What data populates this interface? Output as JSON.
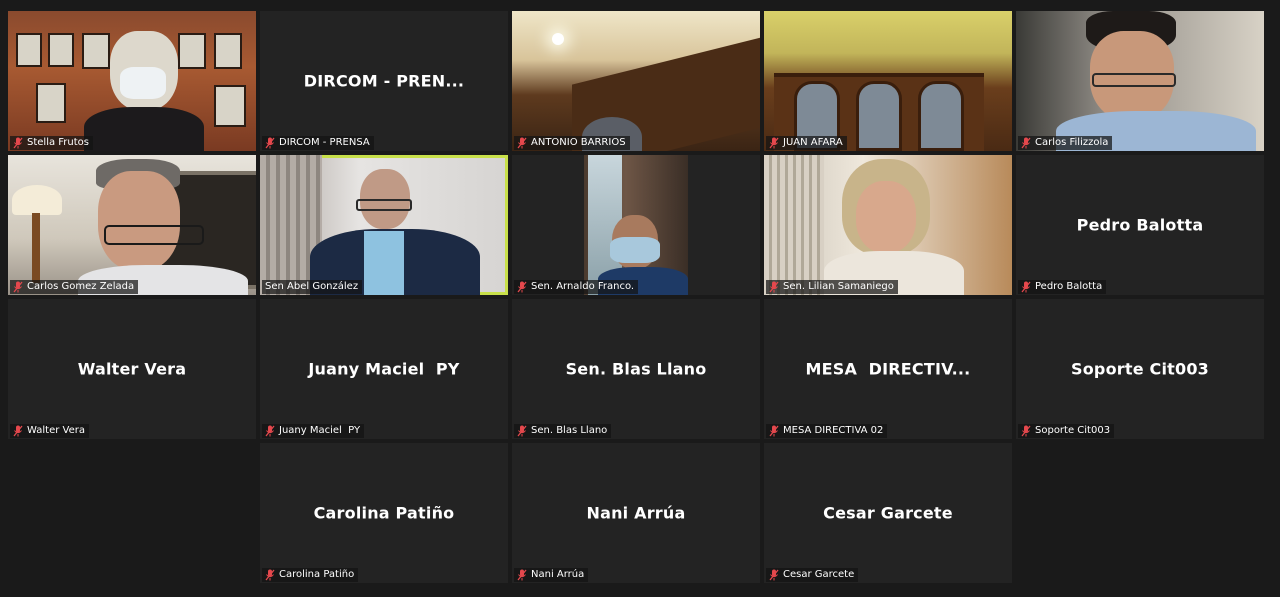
{
  "participants": [
    {
      "name": "Stella Frutos",
      "video": true
    },
    {
      "name": "DIRCOM - PRENSA",
      "display": "DIRCOM - PREN...",
      "video": false
    },
    {
      "name": "ANTONIO BARRIOS",
      "video": true
    },
    {
      "name": "JUAN AFARA",
      "video": true
    },
    {
      "name": "Carlos Filizzola",
      "video": true
    },
    {
      "name": "Carlos Gomez Zelada",
      "video": true
    },
    {
      "name": "Sen Abel González",
      "video": true,
      "active_speaker": true
    },
    {
      "name": "Sen. Arnaldo Franco.",
      "video": true
    },
    {
      "name": "Sen. Lilian Samaniego",
      "video": true
    },
    {
      "name": "Pedro Balotta",
      "display": "Pedro Balotta",
      "video": false
    },
    {
      "name": "Walter Vera",
      "display": "Walter Vera",
      "video": false
    },
    {
      "name": "Juany Maciel  PY",
      "display": "Juany Maciel  PY",
      "video": false
    },
    {
      "name": "Sen. Blas Llano",
      "display": "Sen. Blas Llano",
      "video": false
    },
    {
      "name": "MESA DIRECTIVA 02",
      "display": "MESA  DIRECTIV...",
      "video": false
    },
    {
      "name": "Soporte Cit003",
      "display": "Soporte Cit003",
      "video": false
    },
    {
      "name": "Carolina Patiño",
      "display": "Carolina Patiño",
      "video": false
    },
    {
      "name": "Nani Arrúa",
      "display": "Nani Arrúa",
      "video": false
    },
    {
      "name": "Cesar Garcete",
      "display": "Cesar Garcete",
      "video": false
    }
  ],
  "colors": {
    "background": "#1a1a1a",
    "tile": "#232323",
    "active_speaker_border": "#c8e04a",
    "muted_icon": "#e5484d"
  },
  "icons": {
    "muted": "microphone-muted-icon"
  }
}
